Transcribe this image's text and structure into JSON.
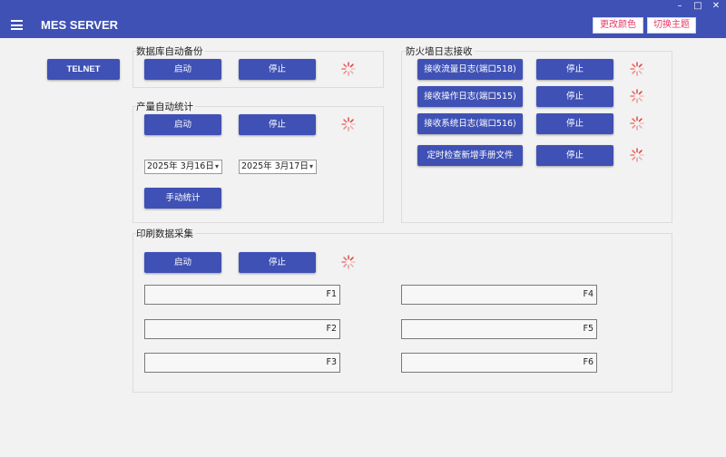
{
  "window": {
    "minimize": "–",
    "maximize": "□",
    "close": "✕"
  },
  "header": {
    "title": "MES SERVER",
    "change_color": "更改颜色",
    "switch_theme": "切换主题"
  },
  "telnet": {
    "label": "TELNET"
  },
  "db_backup": {
    "label": "数据库自动备份",
    "start": "启动",
    "stop": "停止"
  },
  "output_stats": {
    "label": "产量自动统计",
    "start": "启动",
    "stop": "停止",
    "date_from": "2025年  3月16日",
    "date_to": "2025年  3月17日",
    "manual": "手动统计"
  },
  "firewall": {
    "label": "防火墙日志接收",
    "rows": [
      {
        "action": "接收流量日志(端口518)",
        "stop": "停止"
      },
      {
        "action": "接收操作日志(端口515)",
        "stop": "停止"
      },
      {
        "action": "接收系统日志(端口516)",
        "stop": "停止"
      },
      {
        "action": "定时检查新增手册文件",
        "stop": "停止"
      }
    ]
  },
  "print_collect": {
    "label": "印刷数据采集",
    "start": "启动",
    "stop": "停止",
    "fields": [
      "F1",
      "F2",
      "F3",
      "F4",
      "F5",
      "F6"
    ]
  },
  "colors": {
    "primary": "#3f51b5",
    "accent": "#e5396b",
    "spinner": "#e53935"
  }
}
